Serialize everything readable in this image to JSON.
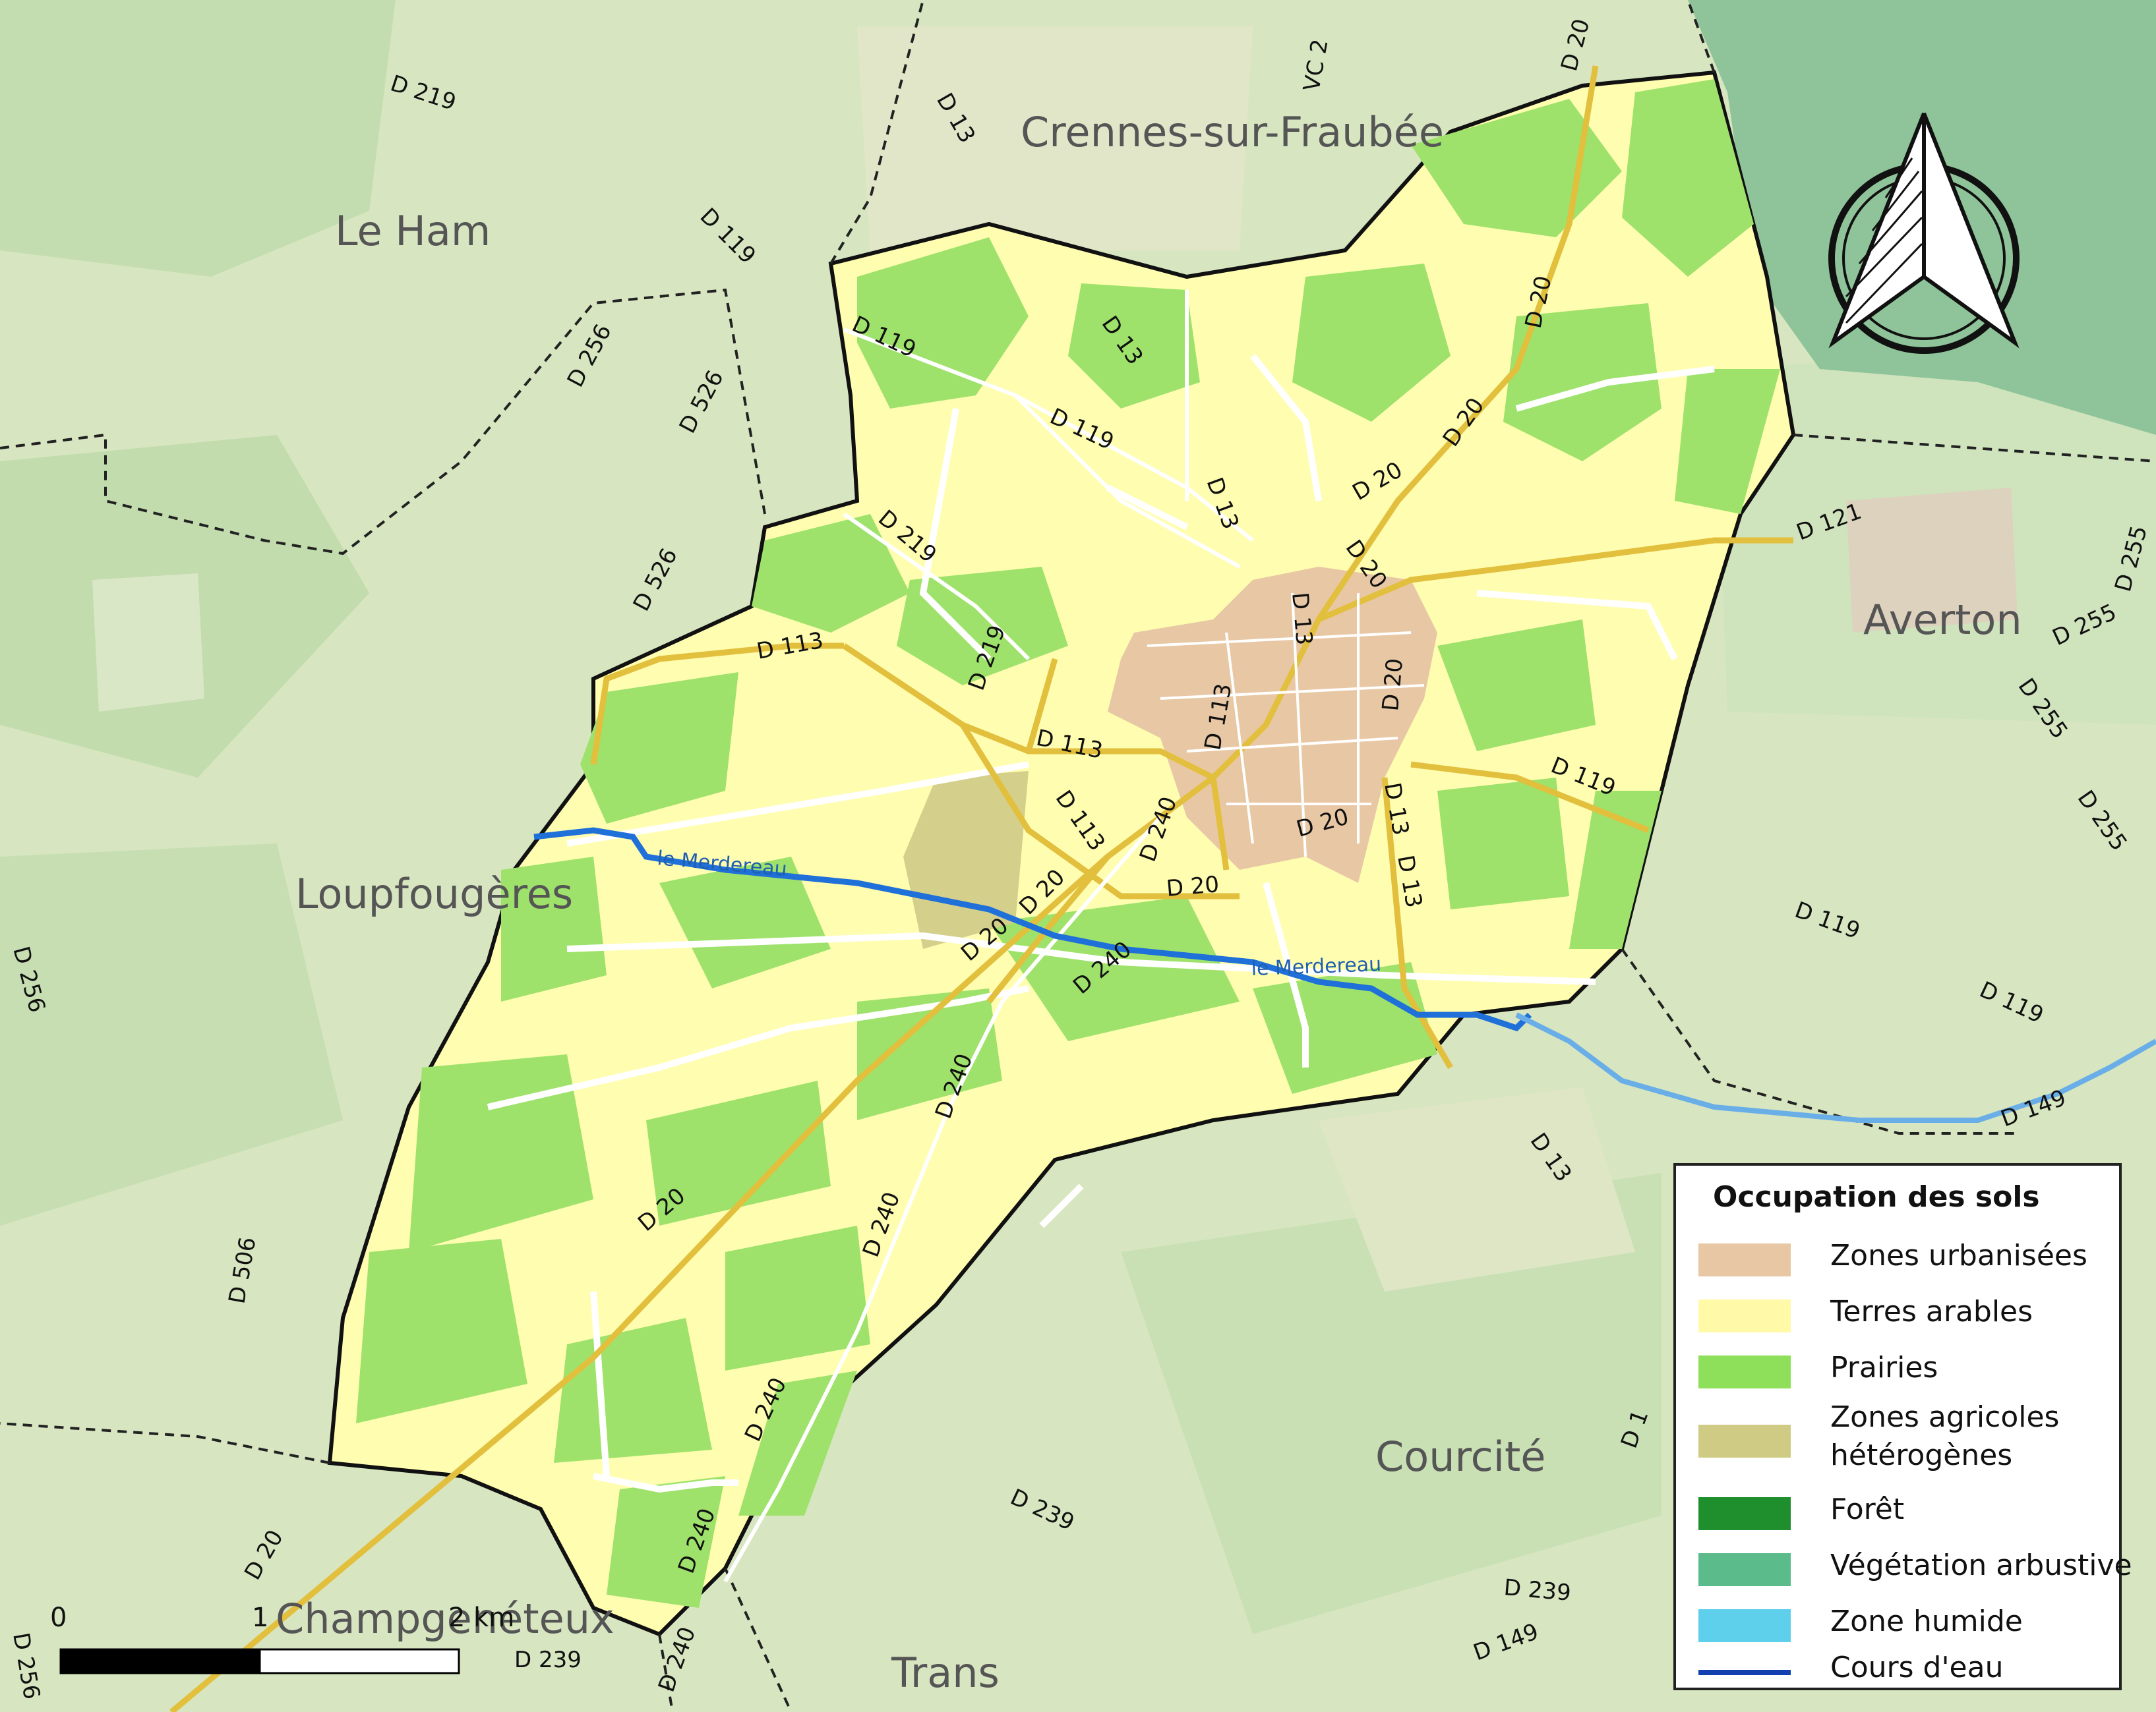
{
  "legend": {
    "title": "Occupation des sols",
    "items": [
      {
        "label": "Zones urbanisées",
        "color": "#e8c8a4"
      },
      {
        "label": "Terres arables",
        "color": "#fff9a8"
      },
      {
        "label": "Prairies",
        "color": "#8ee05a"
      },
      {
        "label": "Zones agricoles hétérogènes",
        "label_line1": "Zones agricoles",
        "label_line2": "hétérogènes",
        "color": "#cfcb84"
      },
      {
        "label": "Forêt",
        "color": "#1f8f2e"
      },
      {
        "label": "Végétation arbustive",
        "color": "#5bbb8a"
      },
      {
        "label": "Zone humide",
        "color": "#5fd0ec"
      },
      {
        "label": "Cours d'eau",
        "color": "#1240b0",
        "type": "line"
      }
    ]
  },
  "places": {
    "crennes": "Crennes-sur-Fraubée",
    "le_ham": "Le Ham",
    "averton": "Averton",
    "loupfougeres": "Loupfougères",
    "courcite": "Courcité",
    "champgeneteux": "Champgenéteux",
    "trans": "Trans"
  },
  "rivers": {
    "merdereau_1": "le Merdereau",
    "merdereau_2": "le Merdereau"
  },
  "roads": {
    "r1": "D 219",
    "r2": "D 119",
    "r3": "D 256",
    "r4": "D 526",
    "r5": "D 526",
    "r6": "D 13",
    "r7": "VC 2",
    "r8": "D 20",
    "r9": "D 119",
    "r10": "D 13",
    "r11": "D 20",
    "r12": "D 20",
    "r13": "D 119",
    "r14": "D 13",
    "r15": "D 20",
    "r16": "D 219",
    "r17": "D 113",
    "r18": "D 219",
    "r19": "D 113",
    "r20": "D 20",
    "r21": "D 13",
    "r22": "D 20",
    "r23": "D 121",
    "r24": "D 255",
    "r25": "D 255",
    "r26": "D 255",
    "r27": "D 255",
    "r28": "D 119",
    "r29": "D 113",
    "r30": "D 240",
    "r31": "D 20",
    "r32": "D 13",
    "r33": "D 20",
    "r34": "D 119",
    "r35": "D 20",
    "r36": "D 240",
    "r37": "D 20",
    "r38": "D 113",
    "r39": "D 256",
    "r40": "D 119",
    "r41": "D 149",
    "r42": "D 240",
    "r43": "D 13",
    "r44": "D 20",
    "r45": "D 240",
    "r46": "D 506",
    "r47": "D 240",
    "r48": "D 239",
    "r49": "D 20",
    "r50": "D 240",
    "r51": "D 239",
    "r52": "D 149",
    "r53": "D 239",
    "r54": "D 240",
    "r55": "D 256",
    "r56": "D 1",
    "r57": "D 13"
  },
  "scale": {
    "label_0": "0",
    "label_1": "1",
    "label_2": "2 km"
  }
}
